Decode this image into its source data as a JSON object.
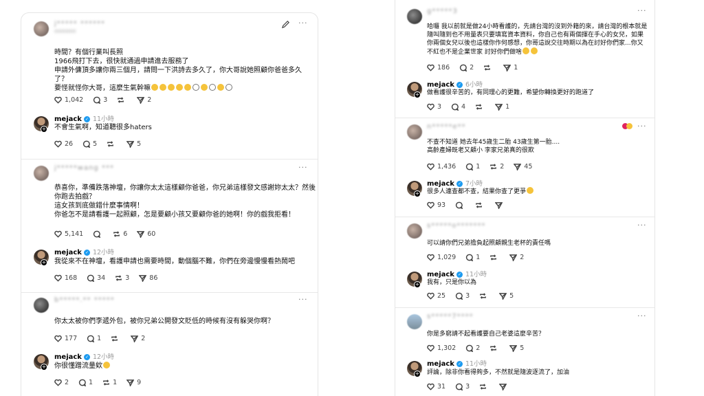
{
  "colors": {
    "verified": "#1d9bf0",
    "text": "#111111",
    "muted": "#9a9a9a",
    "divider": "#e8e8e8"
  },
  "icons": [
    "heart-icon",
    "comment-icon",
    "repost-icon",
    "share-icon",
    "pencil-icon",
    "more-icon",
    "verified-icon"
  ],
  "left": {
    "posts": [
      {
        "user_blurred": "j***** ******",
        "user_blurred_extra": "******",
        "text": "時間？有個行業叫長照\n1966飛打下去，很快就通過申請進去服務了\n申請外傭頂多讓你兩三個月，請問一下洪詩去多久了，你大哥說她照顧你爸爸多久了？\n要怪就怪你大哥，這麼生氣幹嘛",
        "likes": "1,042",
        "comments": "3",
        "reposts": "",
        "shares": "2"
      },
      {
        "user": "mejack",
        "time": "11小時",
        "text": "不會生氣啊，知道聽很多haters",
        "likes": "26",
        "comments": "5",
        "reposts": "",
        "shares": "5"
      },
      {
        "user_blurred": "j*****wang ***",
        "text": "恭喜你，準備跌落神壇，你讓你太太這樣顧你爸爸，你兄弟這樣發文感謝妳太太？然後你跑去拍戲？\n這女孩到底做錯什麼事情啊！\n你爸怎不是請看護一起照顧，怎是要顧小孩又要顧你爸的她啊！你的戲我拒看！",
        "likes": "5,141",
        "comments": "",
        "reposts": "6",
        "shares": "60"
      },
      {
        "user": "mejack",
        "time": "12小時",
        "text": "我從來不在神壇，看護申請也需要時間，動個腦不難，你們在旁邊慢慢看熱鬧吧",
        "likes": "168",
        "comments": "34",
        "reposts": "3",
        "shares": "86"
      },
      {
        "user_blurred": "b*****.** *****",
        "text": "你太太被你們李遞外包，被你兄弟公開發文貶低的時候有沒有躲哭你啊？",
        "likes": "177",
        "comments": "1",
        "reposts": "",
        "shares": "2"
      },
      {
        "user": "mejack",
        "time": "12小時",
        "text": "你很懂蹭流量欸",
        "likes": "2",
        "comments": "1",
        "reposts": "1",
        "shares": "9"
      }
    ]
  },
  "right": {
    "threads": [
      {
        "user_blurred": "g*****3",
        "text": "哈囉 我以前就是做24小時看護的，先請台灣的沒到外籍的來，請台灣的根本就是隨叫隨到也不用量表只要填寫資本資料，你自己也有兩個揮在手心的女兒，如果你兩個女兒以後也這樣你作何感想，你哥這說交往時期以為在討好你們家...你又不紅也不是企業世家 討好你們做啥",
        "likes": "186",
        "comments": "2",
        "reposts": "",
        "shares": "1",
        "reply": {
          "user": "mejack",
          "time": "6小時",
          "text": "做看護很辛苦的，有同理心的更難，希望你轉換更好的跑道了",
          "likes": "3",
          "comments": "4",
          "reposts": "",
          "shares": "1"
        }
      },
      {
        "user_blurred": "n*****e**",
        "text": "不查不知道 她去年45歲生二胎 43歲生第一胎....\n高齡產婦既老又顧小 李家兄弟真的很欺",
        "likes": "1,436",
        "comments": "1",
        "reposts": "2",
        "shares": "45",
        "reply": {
          "user": "mejack",
          "time": "7小時",
          "text": "很多人連查都不查，結果你查了更爭",
          "likes": "93",
          "comments": "",
          "reposts": "",
          "shares": ""
        }
      },
      {
        "user_blurred": "s*****o*******",
        "text": "可以請你們兄弟擔負起照顧親生老杯的責任嗎",
        "likes": "1,029",
        "comments": "1",
        "reposts": "",
        "shares": "2",
        "reply": {
          "user": "mejack",
          "time": "11小時",
          "text": "我有，只是你以為",
          "likes": "25",
          "comments": "3",
          "reposts": "",
          "shares": "5"
        }
      },
      {
        "user_blurred": "s*****7****",
        "text": "你是多窮請不起看護要自己老婆這麼辛苦？",
        "likes": "1,302",
        "comments": "2",
        "reposts": "",
        "shares": "5",
        "reply": {
          "user": "mejack",
          "time": "11小時",
          "text": "評論，除非你看得夠多，不然就是隨波逐流了，加油",
          "likes": "31",
          "comments": "3",
          "reposts": "",
          "shares": ""
        }
      }
    ]
  }
}
